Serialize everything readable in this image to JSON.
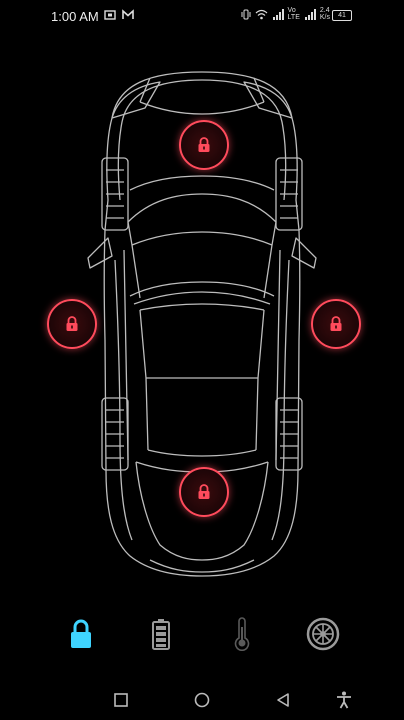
{
  "status_bar": {
    "time": "1:00 AM",
    "network_speed": "2.4",
    "network_unit": "K/s",
    "volte_label": "Vo",
    "lte_label": "LTE",
    "battery_level": "41"
  },
  "car": {
    "lock_state": "locked",
    "accent_color": "#ff4b5c",
    "doors": [
      {
        "name": "front",
        "icon": "lock-icon"
      },
      {
        "name": "left",
        "icon": "lock-icon"
      },
      {
        "name": "right",
        "icon": "lock-icon"
      },
      {
        "name": "rear",
        "icon": "lock-icon"
      }
    ]
  },
  "bottom_nav": {
    "active": "lock",
    "active_color": "#3fd4ff",
    "items": [
      "lock-icon",
      "battery-icon",
      "thermometer-icon",
      "wheel-icon"
    ]
  },
  "system_nav": {
    "items": [
      "recents-square-icon",
      "home-circle-icon",
      "back-triangle-icon",
      "accessibility-icon"
    ]
  }
}
